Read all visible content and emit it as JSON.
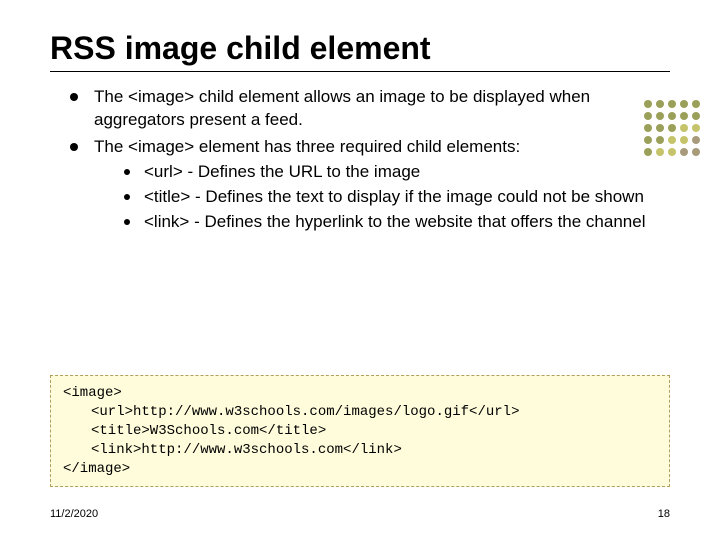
{
  "title": "RSS image child element",
  "bullets": [
    "The <image> child element allows an image to be displayed when aggregators present a feed.",
    "The <image> element has three required child elements:"
  ],
  "sub_bullets": [
    "<url> - Defines the URL to the image",
    "<title> - Defines the text to display if the image could not be shown",
    "<link> - Defines the hyperlink to the website that offers the channel"
  ],
  "code": {
    "l1": "<image>",
    "l2": "<url>http://www.w3schools.com/images/logo.gif</url>",
    "l3": "<title>W3Schools.com</title>",
    "l4": "<link>http://www.w3schools.com</link>",
    "l5": "</image>"
  },
  "footer": {
    "date": "11/2/2020",
    "page": "18"
  }
}
